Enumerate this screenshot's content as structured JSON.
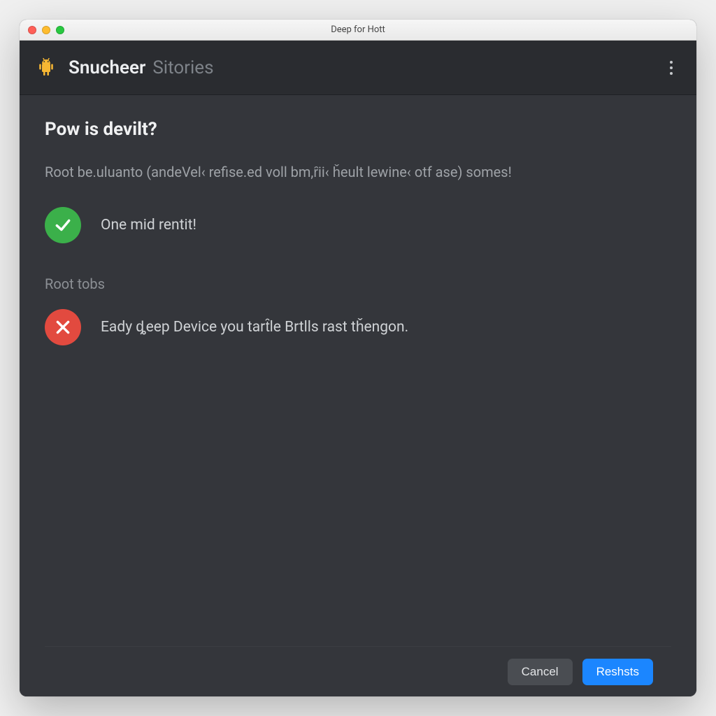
{
  "window": {
    "title": "Deep for Hott"
  },
  "header": {
    "app_name_primary": "Snucheer",
    "app_name_secondary": "Sitories",
    "icon": "android-icon",
    "menu_icon": "more-vertical-icon"
  },
  "main": {
    "heading": "Pow is devilt?",
    "description": "Root be.uluanto (andeVel‹ refise.ed voll bm,ȓii‹ ȟeult lewine‹ otf ase) somes!",
    "status_items": [
      {
        "state": "success",
        "text": "One mid rentit!"
      }
    ],
    "section_label": "Root tobs",
    "error_items": [
      {
        "state": "error",
        "text": "Eady ȡeep Device you tart̑le Brtlls rast tȟengon."
      }
    ]
  },
  "footer": {
    "cancel_label": "Cancel",
    "primary_label": "Reshsts"
  },
  "colors": {
    "success": "#3bb04a",
    "error": "#e24a3f",
    "primary_button": "#1b86ff",
    "app_bg": "#34363b",
    "header_bg": "#2a2c30"
  }
}
